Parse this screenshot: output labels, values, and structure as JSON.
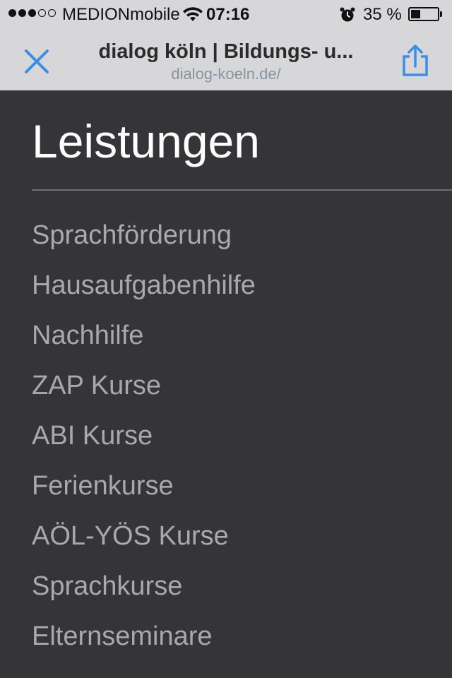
{
  "status_bar": {
    "signal_bars_full": 3,
    "signal_bars_total": 5,
    "carrier": "MEDIONmobile",
    "time": "07:16",
    "battery_text": "35 %",
    "battery_level": 0.35
  },
  "browser": {
    "title": "dialog köln | Bildungs- u...",
    "url": "dialog-koeln.de/",
    "close_icon": "close-icon",
    "share_icon": "share-icon",
    "accent_color": "#3a8ee6"
  },
  "menu": {
    "heading": "Leistungen",
    "items": [
      {
        "label": "Sprachförderung"
      },
      {
        "label": "Hausaufgabenhilfe"
      },
      {
        "label": "Nachhilfe"
      },
      {
        "label": "ZAP Kurse"
      },
      {
        "label": "ABI Kurse"
      },
      {
        "label": "Ferienkurse"
      },
      {
        "label": "AÖL-YÖS Kurse"
      },
      {
        "label": "Sprachkurse"
      },
      {
        "label": "Elternseminare"
      }
    ]
  }
}
